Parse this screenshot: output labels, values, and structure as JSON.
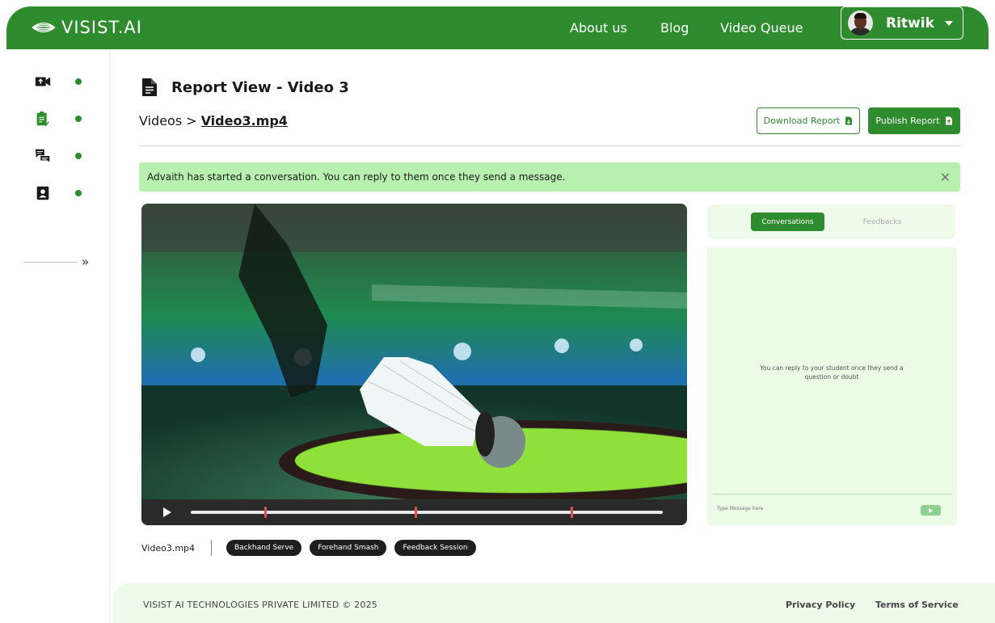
{
  "header": {
    "brand": "VISIST.AI",
    "nav": {
      "about": "About us",
      "blog": "Blog",
      "queue": "Video Queue"
    },
    "user": {
      "name": "Ritwik"
    }
  },
  "sidebar": {
    "items": [
      {
        "icon": "video-upload-icon"
      },
      {
        "icon": "report-clipboard-icon"
      },
      {
        "icon": "chat-icon"
      },
      {
        "icon": "profile-icon"
      }
    ],
    "expand_label": "»"
  },
  "page": {
    "title": "Report View - Video 3",
    "breadcrumb": {
      "parent": "Videos",
      "separator": ">",
      "current": "Video3.mp4"
    },
    "download_label": "Download Report",
    "publish_label": "Publish Report"
  },
  "alert": {
    "message": "Advaith has started a conversation. You can reply to them once they send a message.",
    "close": "✕"
  },
  "video": {
    "file_name": "Video3.mp4",
    "marker_positions": [
      0.155,
      0.475,
      0.805
    ],
    "tags": [
      "Backhand Serve",
      "Forehand Smash",
      "Feedback Session"
    ]
  },
  "panel": {
    "tabs": {
      "active": "Conversations",
      "inactive": "Feedbacks"
    },
    "empty_state": "You can reply to your student once they send a question or doubt",
    "input_placeholder": "Type Message here"
  },
  "footer": {
    "copyright": "VISIST AI TECHNOLOGIES PRIVATE LIMITED © 2025",
    "privacy": "Privacy Policy",
    "terms": "Terms of Service"
  },
  "colors": {
    "brand_green": "#2e8b2e",
    "alert_bg": "#b8f0b0",
    "panel_bg": "#ebfbe6",
    "marker": "#e05050"
  }
}
